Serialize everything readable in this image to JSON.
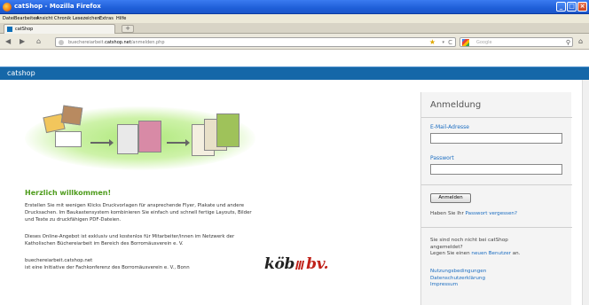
{
  "window": {
    "title": "catShop - Mozilla Firefox",
    "controls": {
      "minimize": "_",
      "maximize": "□",
      "close": "×"
    }
  },
  "menu": [
    "Datei",
    "Bearbeiten",
    "Ansicht",
    "Chronik",
    "Lesezeichen",
    "Extras",
    "Hilfe"
  ],
  "tab": {
    "label": "catShop",
    "new_tab": "+"
  },
  "nav": {
    "back": "◀",
    "forward": "▶",
    "home_site": "⌂",
    "url_prefix": "buechereiarbeit.",
    "url_domain": "catshop.net",
    "url_path": "/anmelden.php",
    "bookmark_star": "★",
    "dropdown": "▾",
    "reload": "C",
    "search_placeholder": "Google",
    "search_icon": "⚲",
    "home": "⌂"
  },
  "site": {
    "brand": "catshop"
  },
  "main": {
    "welcome": "Herzlich willkommen!",
    "intro_lines": [
      "Erstellen Sie mit wenigen Klicks Druckvorlagen für ansprechende Flyer, Plakate und andere",
      "Drucksachen. Im Baukastensystem kombinieren Sie einfach und schnell fertige Layouts, Bilder",
      "und Texte zu druckfähigen PDF-Dateien."
    ],
    "offer_lines": [
      "Dieses Online-Angebot ist exklusiv und kostenlos für Mitarbeiter/innen im Netzwerk der",
      "Katholischen Büchereiarbeit im Bereich des Borromäusverein e. V."
    ],
    "footer_lines": [
      "buechereiarbeit.catshop.net",
      "ist eine Initiative der Fachkonferenz des Borromäusverein e. V., Bonn"
    ],
    "logo": {
      "left": "köb",
      "right": "bv."
    }
  },
  "login": {
    "title": "Anmeldung",
    "email_label": "E-Mail-Adresse",
    "email_value": "",
    "password_label": "Passwort",
    "password_value": "",
    "submit": "Anmelden",
    "forgot_prefix": "Haben Sie Ihr ",
    "forgot_link": "Passwort vergessen?",
    "register_line1": "Sie sind noch nicht bei catShop",
    "register_line2": "angemeldet?",
    "register_prefix": "Legen Sie einen ",
    "register_link": "neuen Benutzer",
    "register_suffix": " an.",
    "links": [
      "Nutzungsbedingungen",
      "Datenschutzerklärung",
      "Impressum"
    ]
  },
  "colors": {
    "header_blue": "#1567a8",
    "welcome_green": "#4e9c1c",
    "link_blue": "#1a6cc0",
    "logo_red": "#c0221a"
  }
}
